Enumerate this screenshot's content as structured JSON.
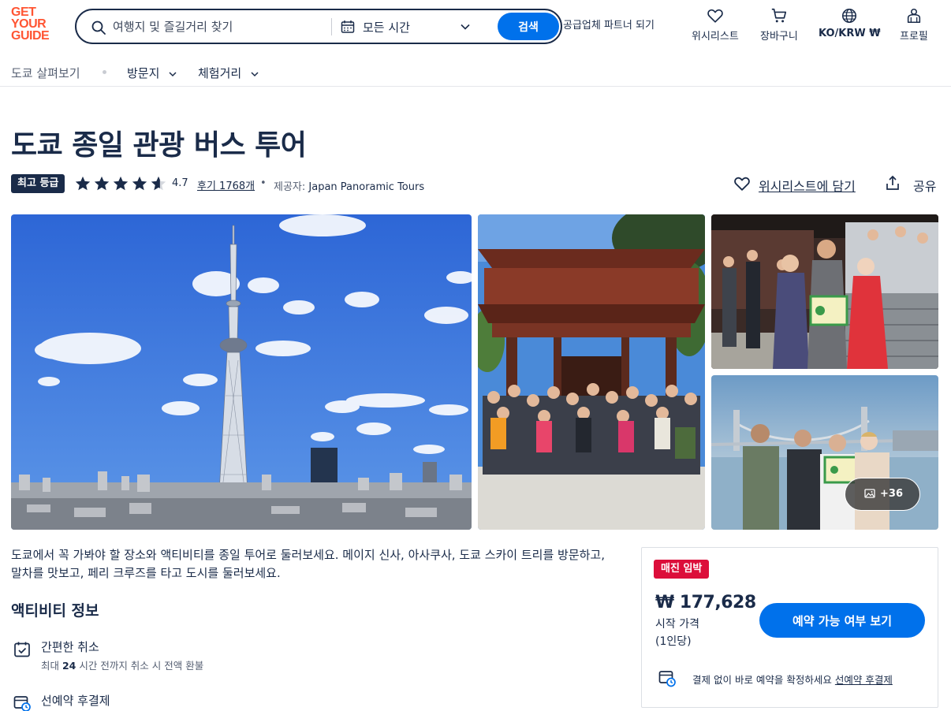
{
  "header": {
    "logo_lines": [
      "GET",
      "YOUR",
      "GUIDE"
    ],
    "search_placeholder": "여행지 및 즐길거리 찾기",
    "date_label": "모든 시간",
    "search_button": "검색",
    "partner_link": "공급업체 파트너 되기",
    "nav": {
      "wishlist": "위시리스트",
      "cart": "장바구니",
      "currency": "KO/KRW ₩",
      "profile": "프로필"
    }
  },
  "subnav": {
    "explore": "도쿄 살펴보기",
    "places": "방문지",
    "activities": "체험거리"
  },
  "product": {
    "title": "도쿄 종일 관광 버스 투어",
    "badge": "최고 등급",
    "rating": "4.7",
    "rating_stars": 4.7,
    "reviews": "후기 1768개",
    "provider_label": "제공자:",
    "provider_name": "Japan Panoramic Tours",
    "wishlist_action": "위시리스트에 담기",
    "share_action": "공유",
    "more_photos": "+36",
    "description": "도쿄에서 꼭 가봐야 할 장소와 액티비티를 종일 투어로 둘러보세요. 메이지 신사, 아사쿠사, 도쿄 스카이 트리를 방문하고, 말차를 맛보고, 페리 크루즈를 타고 도시를 둘러보세요."
  },
  "activity_info": {
    "title": "액티비티 정보",
    "items": [
      {
        "title": "간편한 취소",
        "sub_prefix": "최대 ",
        "sub_bold": "24",
        "sub_suffix": " 시간 전까지 취소 시 전액 환불"
      },
      {
        "title": "선예약 후결제"
      }
    ]
  },
  "booking": {
    "badge": "매진 임박",
    "price": "₩ 177,628",
    "price_label": "시작 가격",
    "price_unit": "(1인당)",
    "cta": "예약 가능 여부 보기",
    "reserve_text": "결제 없이 바로 예약을 확정하세요 ",
    "reserve_link": "선예약 후결제"
  },
  "colors": {
    "brand": "#ff5533",
    "primary_blue": "#0071eb",
    "navy": "#1a2b49",
    "soldout_red": "#dc0e3a"
  }
}
